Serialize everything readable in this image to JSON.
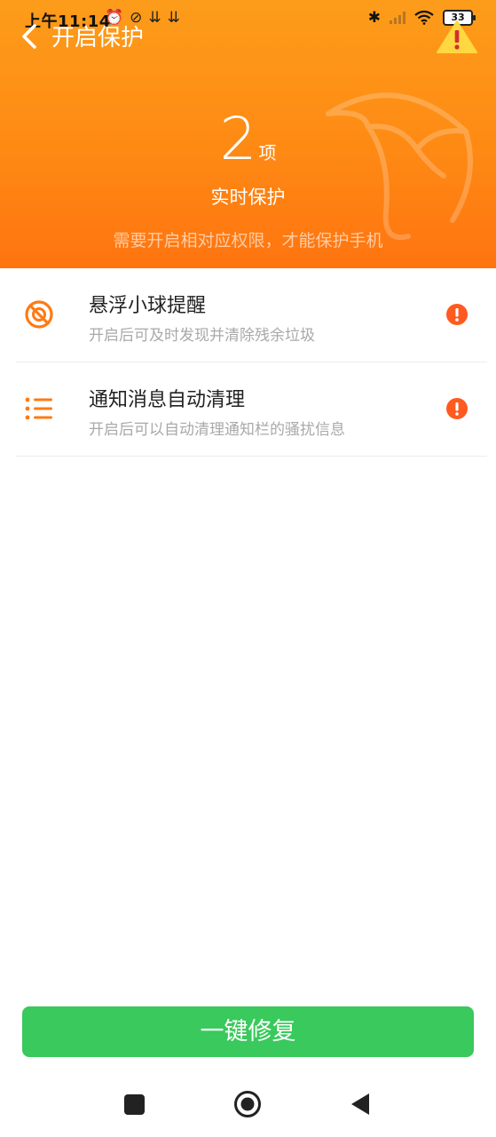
{
  "status_bar": {
    "time": "上午11:14",
    "left_icons": [
      "alarm-off-icon",
      "compass-icon",
      "check-icon",
      "check-icon"
    ],
    "left_glyphs": [
      "⏰",
      "⊘",
      "⇊",
      "⇊"
    ],
    "bluetooth": "✱",
    "battery": "33"
  },
  "header": {
    "title": "开启保护",
    "count": "2",
    "count_unit": "项",
    "subtitle": "实时保护",
    "hint": "需要开启相对应权限，才能保护手机",
    "gradient_colors": [
      "#fd9c1a",
      "#ff7410"
    ]
  },
  "items": [
    {
      "icon": "floating-ball-icon",
      "title": "悬浮小球提醒",
      "desc": "开启后可及时发现并清除残余垃圾",
      "status_icon": "alert-icon"
    },
    {
      "icon": "list-icon",
      "title": "通知消息自动清理",
      "desc": "开启后可以自动清理通知栏的骚扰信息",
      "status_icon": "alert-icon"
    }
  ],
  "fix_button": {
    "label": "一键修复",
    "color": "#39c95c"
  },
  "colors": {
    "accent": "#ff7a12",
    "alert": "#ff5a1f"
  }
}
